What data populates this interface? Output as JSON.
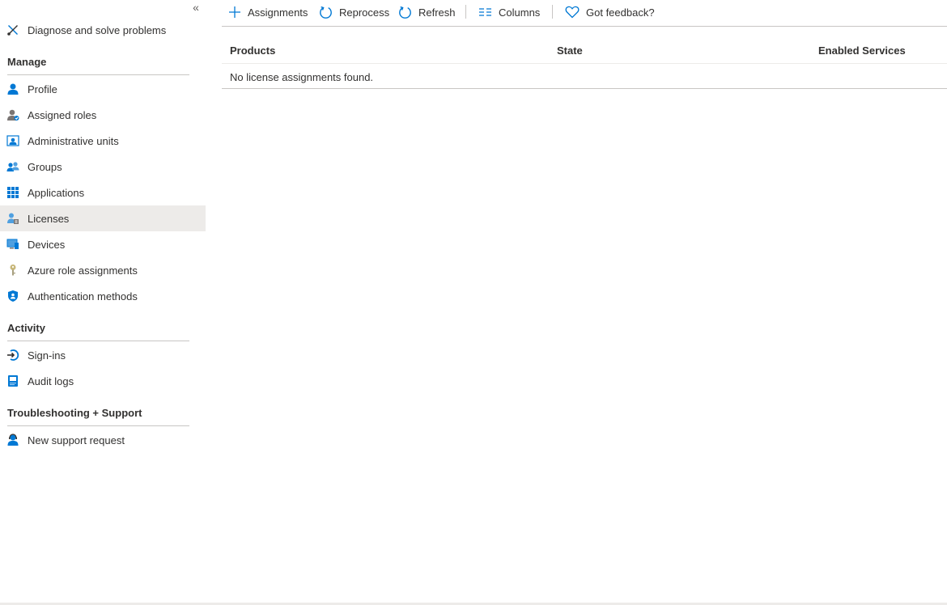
{
  "sidebar": {
    "collapse_glyph": "«",
    "top_item": {
      "label": "Diagnose and solve problems",
      "icon": "wrench-icon"
    },
    "sections": [
      {
        "title": "Manage",
        "items": [
          {
            "label": "Profile",
            "icon": "person-icon"
          },
          {
            "label": "Assigned roles",
            "icon": "user-role-icon"
          },
          {
            "label": "Administrative units",
            "icon": "admin-unit-icon"
          },
          {
            "label": "Groups",
            "icon": "group-icon"
          },
          {
            "label": "Applications",
            "icon": "app-grid-icon"
          },
          {
            "label": "Licenses",
            "icon": "license-icon",
            "active": true
          },
          {
            "label": "Devices",
            "icon": "device-icon"
          },
          {
            "label": "Azure role assignments",
            "icon": "key-icon"
          },
          {
            "label": "Authentication methods",
            "icon": "shield-icon"
          }
        ]
      },
      {
        "title": "Activity",
        "items": [
          {
            "label": "Sign-ins",
            "icon": "sign-in-icon"
          },
          {
            "label": "Audit logs",
            "icon": "audit-log-icon"
          }
        ]
      },
      {
        "title": "Troubleshooting + Support",
        "items": [
          {
            "label": "New support request",
            "icon": "support-person-icon"
          }
        ]
      }
    ]
  },
  "toolbar": {
    "assignments": "Assignments",
    "reprocess": "Reprocess",
    "refresh": "Refresh",
    "columns": "Columns",
    "feedback": "Got feedback?"
  },
  "table": {
    "columns": [
      "Products",
      "State",
      "Enabled Services"
    ],
    "empty_message": "No license assignments found."
  },
  "colors": {
    "accent": "#0078d4",
    "active_bg": "#edebe9",
    "divider": "#c8c6c4",
    "text": "#323130"
  }
}
